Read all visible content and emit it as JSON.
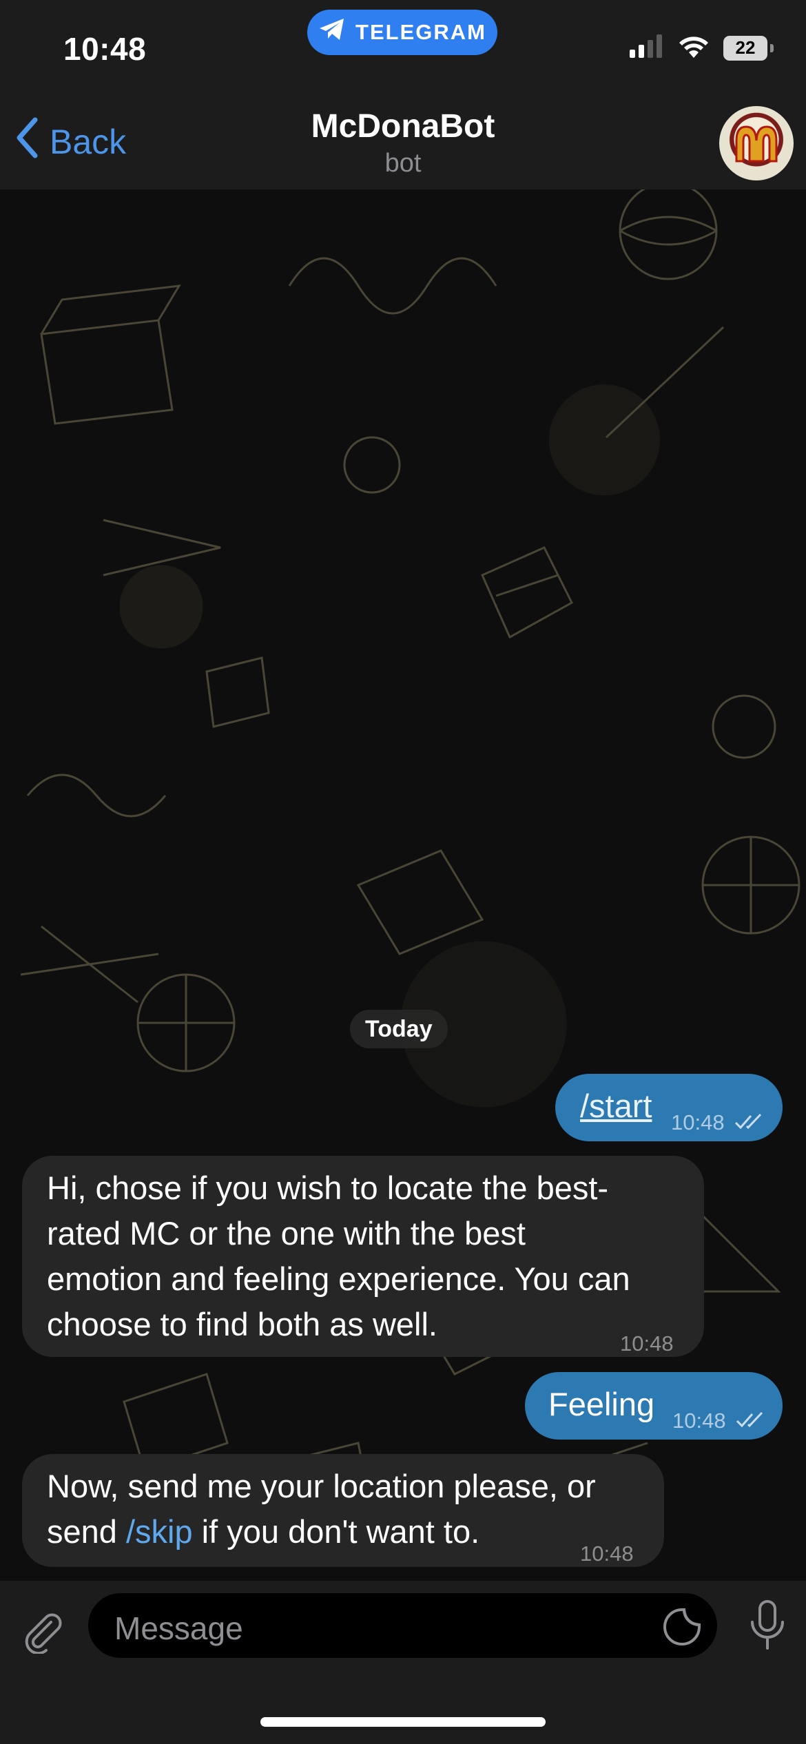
{
  "status_bar": {
    "time": "10:48",
    "app_pill": "TELEGRAM",
    "battery": "22"
  },
  "header": {
    "back_label": "Back",
    "title": "McDonaBot",
    "subtitle": "bot"
  },
  "chat": {
    "date_chip": "Today",
    "messages": [
      {
        "direction": "out",
        "text": "/start",
        "time": "10:48",
        "status": "read"
      },
      {
        "direction": "in",
        "text": "Hi, chose if you wish to locate the best-rated MC or the one with the best emotion and feeling experience. You can choose to find both as well.",
        "lines": [
          "Hi, chose if you wish to locate the best-",
          "rated MC or the one with the best",
          "emotion and feeling experience. You can",
          "choose to find both as well."
        ],
        "time": "10:48"
      },
      {
        "direction": "out",
        "text": "Feeling",
        "time": "10:48",
        "status": "read"
      },
      {
        "direction": "in",
        "line1": "Now, send me your location please, or",
        "line2_before": "send ",
        "line2_command": "/skip",
        "line2_after": " if you don't want to.",
        "time": "10:48"
      }
    ]
  },
  "input": {
    "placeholder": "Message"
  },
  "colors": {
    "accent": "#2f7ff0",
    "outgoing_bubble": "#2d79b2",
    "incoming_bubble": "#262626",
    "link": "#5fa9ee"
  }
}
